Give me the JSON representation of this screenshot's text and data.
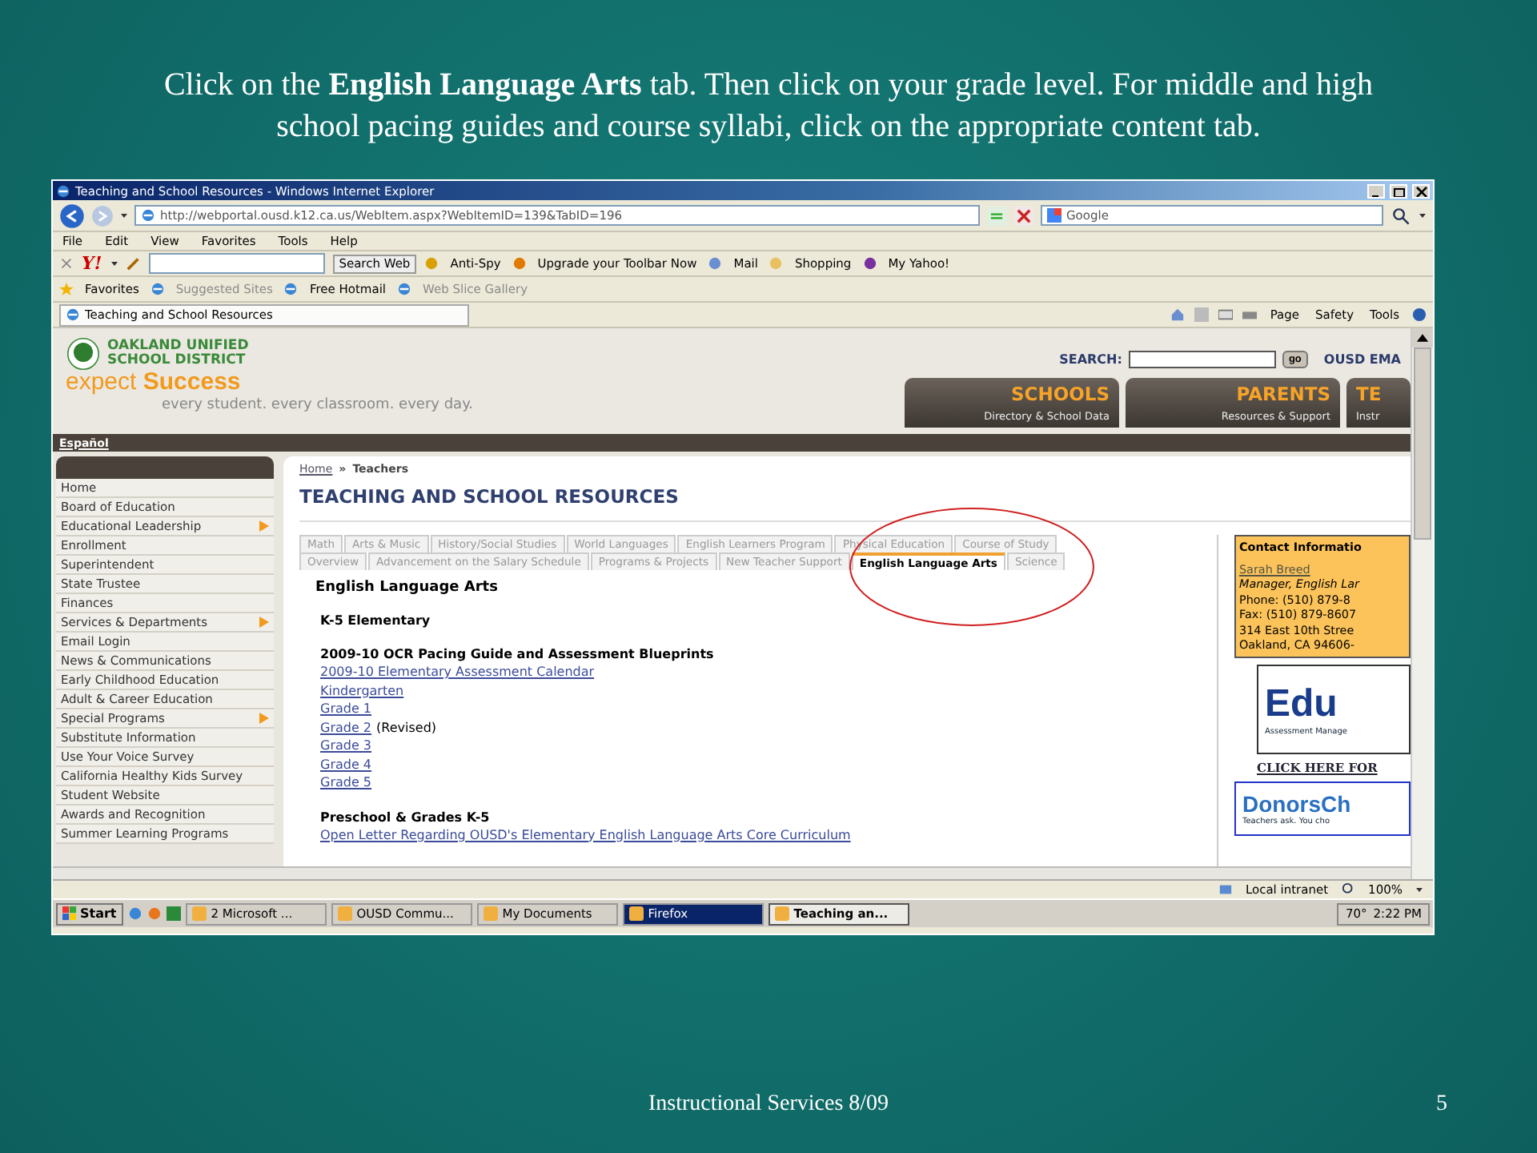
{
  "slide": {
    "title": "Click on the **English Language Arts** tab.  Then click on your grade level.  For middle and high school pacing guides and course syllabi, click on the appropriate content tab.",
    "footer": "Instructional Services 8/09",
    "page_number": "5"
  },
  "browser": {
    "title": "Teaching and School Resources - Windows Internet Explorer",
    "address": "http://webportal.ousd.k12.ca.us/WebItem.aspx?WebItemID=139&TabID=196",
    "search_placeholder": "Google",
    "menu": [
      "File",
      "Edit",
      "View",
      "Favorites",
      "Tools",
      "Help"
    ],
    "toolbar": {
      "logo": "Y!",
      "search_button": "Search Web",
      "items": [
        "Anti-Spy",
        "Upgrade your Toolbar Now",
        "Mail",
        "Shopping",
        "My Yahoo!"
      ]
    },
    "favorites": {
      "label": "Favorites",
      "links": [
        {
          "label": "Suggested Sites",
          "disabled": true
        },
        {
          "label": "Free Hotmail",
          "disabled": false
        },
        {
          "label": "Web Slice Gallery",
          "disabled": true
        }
      ]
    },
    "tab": "Teaching and School Resources",
    "commands": [
      "Page",
      "Safety",
      "Tools"
    ]
  },
  "site": {
    "org_line1": "OAKLAND UNIFIED",
    "org_line2": "SCHOOL DISTRICT",
    "slogan_a": "expect",
    "slogan_b": "Success",
    "tagline": "every student. every classroom. every day.",
    "search_label": "SEARCH:",
    "go": "go",
    "email": "OUSD EMA",
    "nav_tabs": [
      {
        "title": "SCHOOLS",
        "sub": "Directory & School Data"
      },
      {
        "title": "PARENTS",
        "sub": "Resources & Support"
      },
      {
        "title": "TE",
        "sub": "Instr"
      }
    ],
    "language": "Español",
    "sidebar": [
      {
        "label": "Home",
        "submenu": false
      },
      {
        "label": "Board of Education",
        "submenu": false
      },
      {
        "label": "Educational Leadership",
        "submenu": true
      },
      {
        "label": "Enrollment",
        "submenu": false
      },
      {
        "label": "Superintendent",
        "submenu": false
      },
      {
        "label": "State Trustee",
        "submenu": false
      },
      {
        "label": "Finances",
        "submenu": false
      },
      {
        "label": "Services & Departments",
        "submenu": true
      },
      {
        "label": "Email Login",
        "submenu": false
      },
      {
        "label": "News & Communications",
        "submenu": false
      },
      {
        "label": "Early Childhood Education",
        "submenu": false
      },
      {
        "label": "Adult & Career Education",
        "submenu": false
      },
      {
        "label": "Special Programs",
        "submenu": true
      },
      {
        "label": "Substitute Information",
        "submenu": false
      },
      {
        "label": "Use Your Voice Survey",
        "submenu": false
      },
      {
        "label": "California Healthy Kids Survey",
        "submenu": false
      },
      {
        "label": "Student Website",
        "submenu": false
      },
      {
        "label": "Awards and Recognition",
        "submenu": false
      },
      {
        "label": "Summer Learning Programs",
        "submenu": false
      }
    ],
    "breadcrumb": {
      "home": "Home",
      "separator": "»",
      "current": "Teachers"
    },
    "heading": "TEACHING AND SCHOOL RESOURCES",
    "tab_rows": [
      [
        {
          "label": "Math",
          "selected": false
        },
        {
          "label": "Arts & Music",
          "selected": false
        },
        {
          "label": "History/Social Studies",
          "selected": false
        },
        {
          "label": "World Languages",
          "selected": false
        },
        {
          "label": "English Learners Program",
          "selected": false
        },
        {
          "label": "Physical Education",
          "selected": false
        },
        {
          "label": "Course of Study",
          "selected": false
        }
      ],
      [
        {
          "label": "Overview",
          "selected": false
        },
        {
          "label": "Advancement on the Salary Schedule",
          "selected": false
        },
        {
          "label": "Programs & Projects",
          "selected": false
        },
        {
          "label": "New Teacher Support",
          "selected": false
        },
        {
          "label": "English Language Arts",
          "selected": true
        },
        {
          "label": "Science",
          "selected": false
        }
      ]
    ],
    "content": {
      "title": "English Language Arts",
      "sections": [
        {
          "heading": "K-5 Elementary"
        },
        {
          "heading": "2009-10 OCR Pacing Guide and Assessment Blueprints",
          "items": [
            {
              "link": "2009-10 Elementary Assessment Calendar"
            },
            {
              "link": "Kindergarten"
            },
            {
              "link": "Grade 1"
            },
            {
              "link": "Grade 2",
              "note": "(Revised)"
            },
            {
              "link": "Grade 3"
            },
            {
              "link": "Grade 4"
            },
            {
              "link": "Grade 5"
            }
          ]
        },
        {
          "heading": "Preschool & Grades K-5",
          "items": [
            {
              "link": "Open Letter Regarding OUSD's Elementary English Language Arts Core Curriculum"
            }
          ]
        }
      ]
    },
    "contact": {
      "title": "Contact Informatio",
      "name": "Sarah Breed",
      "role": "Manager, English Lar",
      "lines": [
        "Phone: (510) 879-8",
        "Fax: (510) 879-8607",
        "314 East 10th Stree",
        "Oakland, CA 94606-"
      ]
    },
    "banner_1": {
      "brand": "Edu",
      "sub": "Assessment Manage",
      "link": "CLICK HERE FOR"
    },
    "banner_2": {
      "brand": "DonorsCh",
      "sub": "Teachers ask. You cho"
    }
  },
  "status": {
    "zone": "Local intranet",
    "zoom": "100%"
  },
  "taskbar": {
    "start": "Start",
    "items": [
      {
        "label": "2 Microsoft ...",
        "selected": false,
        "highlighted": false
      },
      {
        "label": "OUSD Commu...",
        "selected": false,
        "highlighted": false
      },
      {
        "label": "My Documents",
        "selected": false,
        "highlighted": false
      },
      {
        "label": "Firefox",
        "selected": false,
        "highlighted": true
      },
      {
        "label": "Teaching an...",
        "selected": true,
        "highlighted": false
      }
    ],
    "temperature": "70°",
    "clock": "2:22 PM"
  }
}
